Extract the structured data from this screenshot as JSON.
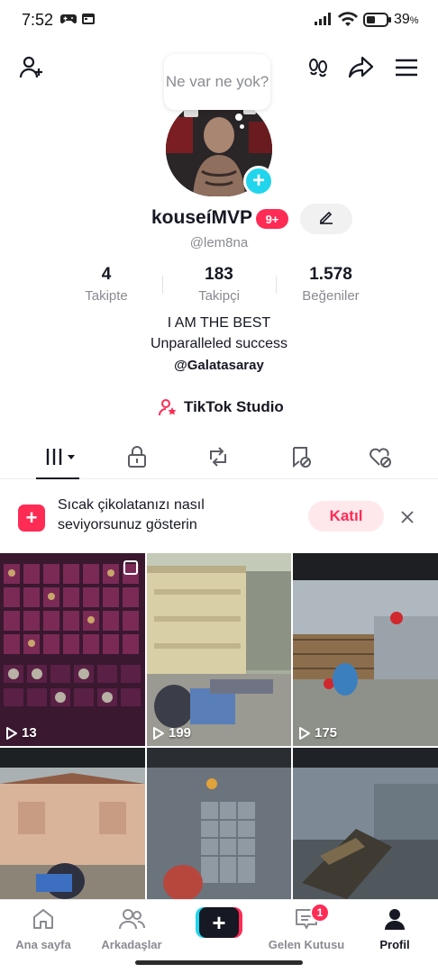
{
  "status_bar": {
    "time": "7:52",
    "battery_percent": "39",
    "battery_symbol": "%"
  },
  "header": {
    "icons": [
      "add-user-icon",
      "footprints-icon",
      "share-icon",
      "menu-icon"
    ]
  },
  "profile": {
    "bubble_text": "Ne var ne yok?",
    "username": "kouseíMVP",
    "badge": "9+",
    "handle": "@lem8na"
  },
  "stats": [
    {
      "value": "4",
      "label": "Takipte"
    },
    {
      "value": "183",
      "label": "Takipçi"
    },
    {
      "value": "1.578",
      "label": "Beğeniler"
    }
  ],
  "bio": {
    "line1": "I AM THE BEST",
    "line2": "Unparalleled success",
    "mention": "@Galatasaray"
  },
  "studio_link": "TikTok Studio",
  "tabs": [
    "videos-grid-icon",
    "lock-icon",
    "repost-icon",
    "saved-icon",
    "liked-icon"
  ],
  "promo": {
    "text": "Sıcak çikolatanızı nasıl seviyorsunuz gösterin",
    "button": "Katıl"
  },
  "videos": [
    {
      "views": "13",
      "theme": "inventory"
    },
    {
      "views": "199",
      "theme": "building"
    },
    {
      "views": "175",
      "theme": "fence"
    },
    {
      "views": "",
      "theme": "house"
    },
    {
      "views": "",
      "theme": "corridor"
    },
    {
      "views": "",
      "theme": "gun"
    }
  ],
  "bottom_nav": {
    "home": "Ana sayfa",
    "friends": "Arkadaşlar",
    "inbox": "Gelen Kutusu",
    "inbox_badge": "1",
    "profile": "Profil"
  },
  "colors": {
    "accent": "#fe2c55",
    "cyan": "#20d5ec",
    "text": "#161823",
    "muted": "#8a8b91"
  }
}
